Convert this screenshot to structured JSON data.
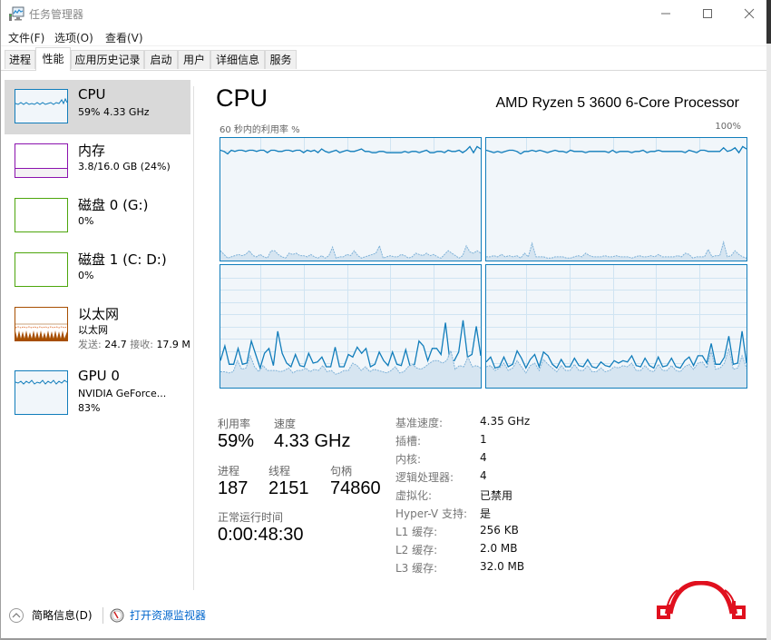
{
  "window": {
    "title": "任务管理器",
    "controls": {
      "minimize": "minimize-icon",
      "maximize": "maximize-icon",
      "close": "close-icon"
    }
  },
  "menu": [
    {
      "label": "文件(F)"
    },
    {
      "label": "选项(O)"
    },
    {
      "label": "查看(V)"
    }
  ],
  "tabs": [
    {
      "label": "进程",
      "active": false
    },
    {
      "label": "性能",
      "active": true
    },
    {
      "label": "应用历史记录",
      "active": false
    },
    {
      "label": "启动",
      "active": false
    },
    {
      "label": "用户",
      "active": false
    },
    {
      "label": "详细信息",
      "active": false
    },
    {
      "label": "服务",
      "active": false
    }
  ],
  "sidebar": {
    "items": [
      {
        "title": "CPU",
        "line1": "59% 4.33 GHz",
        "color": "#117dbb",
        "selected": true
      },
      {
        "title": "内存",
        "line1": "3.8/16.0 GB (24%)",
        "color": "#8b12ae",
        "selected": false
      },
      {
        "title": "磁盘 0 (G:)",
        "line1": "0%",
        "color": "#4da60c",
        "selected": false
      },
      {
        "title": "磁盘 1 (C: D:)",
        "line1": "0%",
        "color": "#4da60c",
        "selected": false
      },
      {
        "title": "以太网",
        "line1": "以太网",
        "send_label": "发送:",
        "send_value": "24.7",
        "recv_label": "接收:",
        "recv_value": "17.9 M",
        "color": "#a74f01",
        "selected": false
      },
      {
        "title": "GPU 0",
        "line1": "NVIDIA GeForce...",
        "line2": "83%",
        "color": "#117dbb",
        "selected": false
      }
    ]
  },
  "main": {
    "title": "CPU",
    "processor": "AMD Ryzen 5 3600 6-Core Processor",
    "graph_label": "60 秒内的利用率 %",
    "graph_max": "100%",
    "graph_color": "#117dbb",
    "core_graphs": [
      {
        "name": "core-graph-1",
        "total_pct": [
          90,
          89,
          87,
          90,
          89,
          90,
          90,
          89,
          90,
          90,
          89,
          90,
          90,
          88,
          90,
          90,
          89,
          89,
          90,
          90,
          89,
          90,
          90,
          88,
          90,
          89,
          90,
          88,
          91,
          89,
          88,
          89,
          90,
          88,
          89,
          90,
          89,
          89,
          90,
          91,
          89,
          89,
          88,
          88,
          89,
          89,
          88,
          88,
          88,
          88,
          88,
          89,
          88,
          89,
          89,
          88,
          89,
          90,
          88,
          88,
          89,
          89,
          88,
          90,
          89,
          89,
          90,
          88,
          90,
          93,
          88,
          93,
          91
        ],
        "kernel_pct": [
          8,
          5,
          2,
          3,
          4,
          5,
          4,
          5,
          8,
          4,
          3,
          5,
          3,
          2,
          8,
          8,
          5,
          3,
          2,
          6,
          5,
          6,
          4,
          4,
          3,
          5,
          3,
          2,
          4,
          2,
          4,
          11,
          2,
          3,
          3,
          5,
          4,
          8,
          4,
          2,
          3,
          4,
          5,
          6,
          12,
          2,
          3,
          4,
          3,
          3,
          5,
          4,
          2,
          3,
          6,
          5,
          4,
          6,
          4,
          5,
          3,
          2,
          5,
          8,
          6,
          4,
          2,
          4,
          12,
          7,
          6,
          8,
          6
        ]
      },
      {
        "name": "core-graph-2",
        "total_pct": [
          90,
          89,
          88,
          89,
          88,
          89,
          90,
          90,
          89,
          87,
          89,
          89,
          90,
          89,
          90,
          89,
          88,
          89,
          90,
          89,
          89,
          88,
          90,
          89,
          89,
          89,
          88,
          89,
          89,
          89,
          89,
          89,
          88,
          90,
          88,
          89,
          89,
          89,
          88,
          89,
          89,
          90,
          88,
          89,
          89,
          90,
          89,
          89,
          89,
          89,
          89,
          89,
          88,
          90,
          89,
          88,
          90,
          90,
          89,
          89,
          89,
          89,
          92,
          89,
          90,
          92,
          88,
          93,
          91
        ],
        "kernel_pct": [
          3,
          3,
          4,
          3,
          5,
          3,
          4,
          3,
          4,
          2,
          6,
          3,
          14,
          3,
          3,
          3,
          2,
          2,
          3,
          3,
          3,
          2,
          2,
          3,
          4,
          3,
          6,
          4,
          3,
          3,
          3,
          4,
          3,
          3,
          4,
          3,
          3,
          3,
          2,
          3,
          4,
          3,
          3,
          4,
          3,
          5,
          3,
          3,
          3,
          3,
          4,
          3,
          6,
          5,
          2,
          3,
          3,
          3,
          9,
          3,
          4,
          4,
          15,
          3,
          4,
          8,
          5,
          3,
          2
        ]
      },
      {
        "name": "core-graph-3",
        "total_pct": [
          22,
          34,
          19,
          19,
          32,
          19,
          20,
          38,
          27,
          16,
          28,
          32,
          18,
          46,
          28,
          20,
          17,
          27,
          18,
          17,
          28,
          20,
          21,
          25,
          17,
          17,
          33,
          17,
          17,
          27,
          25,
          33,
          28,
          32,
          17,
          19,
          29,
          22,
          18,
          29,
          19,
          18,
          31,
          17,
          19,
          38,
          34,
          22,
          32,
          32,
          27,
          53,
          22,
          22,
          29,
          55,
          25,
          27,
          50,
          26
        ],
        "kernel_pct": [
          13,
          13,
          12,
          13,
          22,
          15,
          16,
          26,
          17,
          13,
          18,
          14,
          14,
          14,
          13,
          14,
          16,
          12,
          14,
          14,
          16,
          13,
          15,
          14,
          18,
          13,
          14,
          11,
          12,
          14,
          14,
          20,
          18,
          14,
          17,
          13,
          15,
          14,
          13,
          12,
          14,
          17,
          12,
          13,
          17,
          19,
          16,
          15,
          17,
          20,
          22,
          22,
          20,
          22,
          30,
          15,
          18,
          17,
          25,
          17,
          18,
          16
        ]
      },
      {
        "name": "core-graph-4",
        "total_pct": [
          21,
          25,
          16,
          17,
          25,
          17,
          19,
          30,
          24,
          16,
          23,
          27,
          17,
          29,
          26,
          19,
          16,
          23,
          17,
          17,
          24,
          18,
          17,
          23,
          17,
          16,
          21,
          18,
          17,
          22,
          20,
          22,
          21,
          26,
          18,
          17,
          24,
          18,
          16,
          25,
          17,
          18,
          24,
          17,
          16,
          22,
          25,
          18,
          26,
          26,
          20,
          36,
          19,
          19,
          25,
          42,
          19,
          20,
          46,
          20
        ],
        "kernel_pct": [
          17,
          18,
          14,
          16,
          20,
          14,
          16,
          22,
          17,
          12,
          18,
          20,
          14,
          23,
          19,
          16,
          13,
          18,
          14,
          14,
          19,
          14,
          14,
          18,
          13,
          13,
          16,
          13,
          14,
          17,
          16,
          18,
          17,
          20,
          14,
          14,
          18,
          14,
          13,
          19,
          14,
          14,
          18,
          14,
          13,
          17,
          19,
          15,
          20,
          21,
          16,
          30,
          15,
          16,
          20,
          32,
          15,
          16,
          26,
          16
        ]
      }
    ],
    "stats": {
      "utilization_label": "利用率",
      "utilization_value": "59%",
      "speed_label": "速度",
      "speed_value": "4.33 GHz",
      "processes_label": "进程",
      "processes_value": "187",
      "threads_label": "线程",
      "threads_value": "2151",
      "handles_label": "句柄",
      "handles_value": "74860",
      "uptime_label": "正常运行时间",
      "uptime_value": "0:00:48:30"
    },
    "specs": [
      {
        "label": "基准速度:",
        "value": "4.35 GHz"
      },
      {
        "label": "插槽:",
        "value": "1"
      },
      {
        "label": "内核:",
        "value": "4"
      },
      {
        "label": "逻辑处理器:",
        "value": "4"
      },
      {
        "label": "虚拟化:",
        "value": "已禁用"
      },
      {
        "label": "Hyper-V 支持:",
        "value": "是"
      },
      {
        "label": "L1 缓存:",
        "value": "256 KB"
      },
      {
        "label": "L2 缓存:",
        "value": "2.0 MB"
      },
      {
        "label": "L3 缓存:",
        "value": "32.0 MB"
      }
    ]
  },
  "footer": {
    "fewer_details": "简略信息(D)",
    "open_resmon": "打开资源监视器"
  },
  "watermark": {
    "color": "#e0101e"
  }
}
